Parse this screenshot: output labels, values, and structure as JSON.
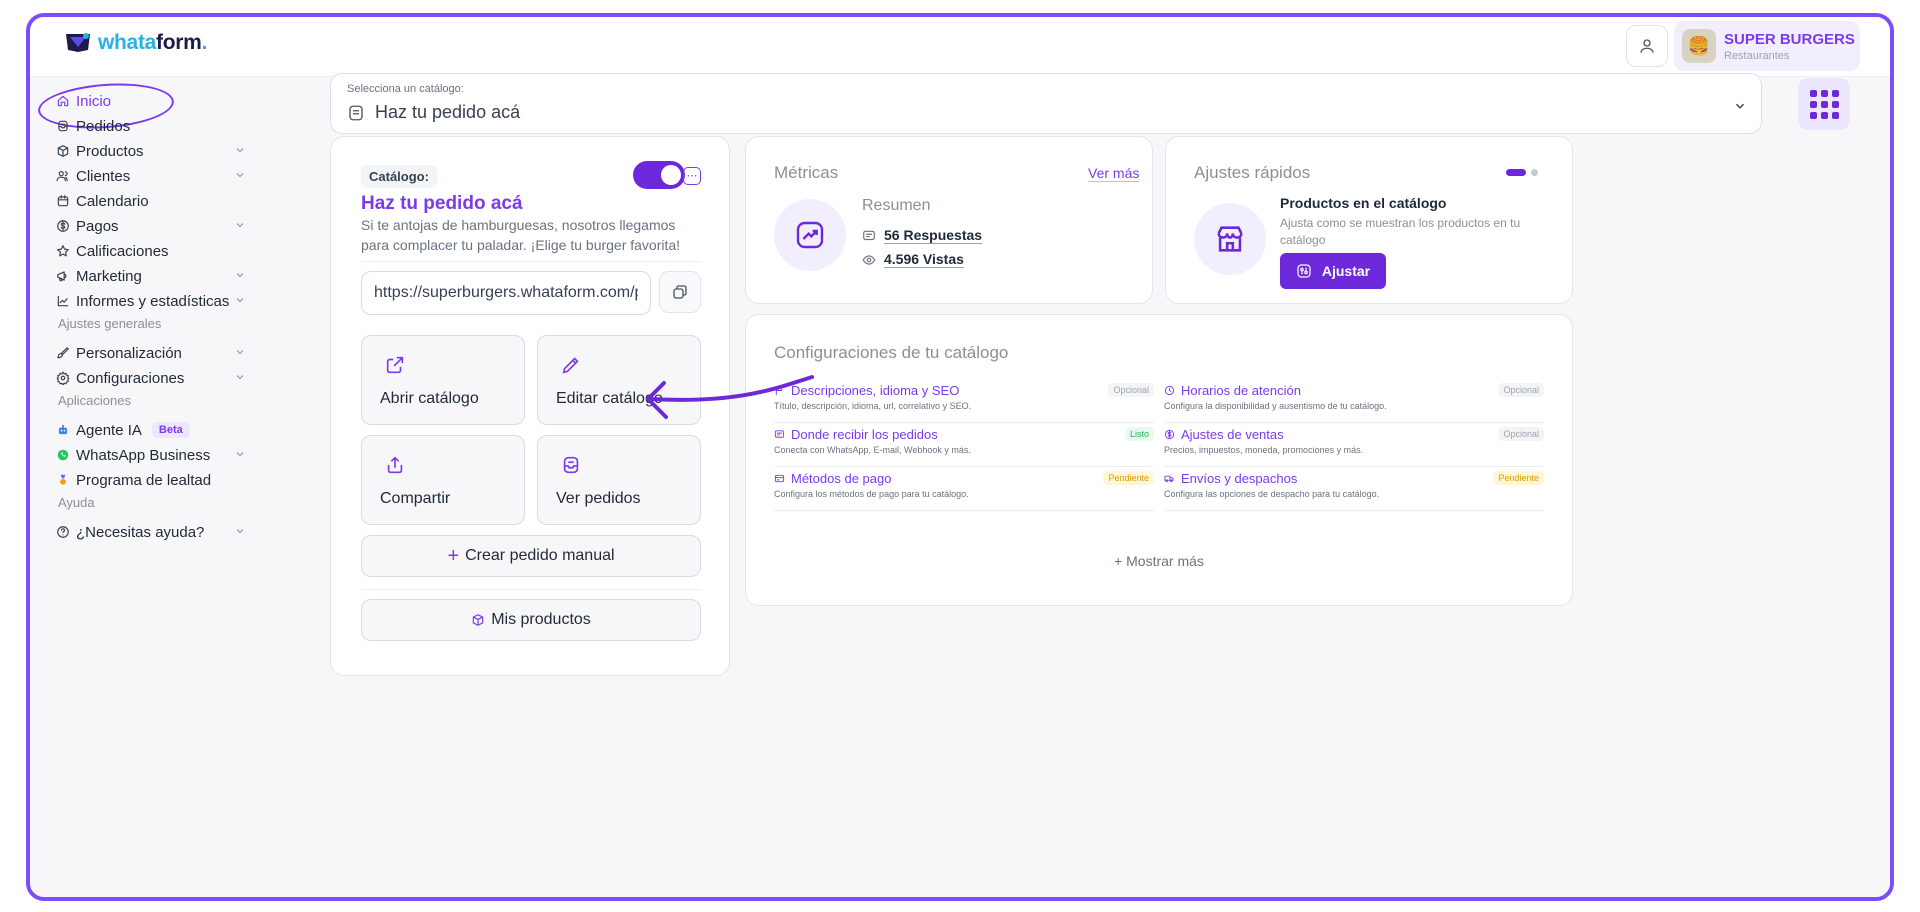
{
  "brand": {
    "name_part1": "whata",
    "name_part2": "form",
    "name_dot": "."
  },
  "account": {
    "name": "SUPER BURGERS",
    "subtitle": "Restaurantes"
  },
  "sidebar": {
    "items": [
      {
        "label": "Inicio",
        "icon": "home-icon",
        "chevron": false,
        "active": true
      },
      {
        "label": "Pedidos",
        "icon": "orders-icon",
        "chevron": false
      },
      {
        "label": "Productos",
        "icon": "box-icon",
        "chevron": true
      },
      {
        "label": "Clientes",
        "icon": "users-icon",
        "chevron": true
      },
      {
        "label": "Calendario",
        "icon": "calendar-icon",
        "chevron": false
      },
      {
        "label": "Pagos",
        "icon": "dollar-icon",
        "chevron": true
      },
      {
        "label": "Calificaciones",
        "icon": "star-icon",
        "chevron": false
      },
      {
        "label": "Marketing",
        "icon": "megaphone-icon",
        "chevron": true
      },
      {
        "label": "Informes y estadísticas",
        "icon": "chart-icon",
        "chevron": true
      }
    ],
    "heading_general": "Ajustes generales",
    "general_items": [
      {
        "label": "Personalización",
        "icon": "brush-icon",
        "chevron": true
      },
      {
        "label": "Configuraciones",
        "icon": "gear-icon",
        "chevron": true
      }
    ],
    "heading_apps": "Aplicaciones",
    "app_items": [
      {
        "label": "Agente IA",
        "icon": "robot-icon",
        "badge": "Beta",
        "chevron": false
      },
      {
        "label": "WhatsApp Business",
        "icon": "whatsapp-icon",
        "chevron": true
      },
      {
        "label": "Programa de lealtad",
        "icon": "medal-icon",
        "chevron": false
      }
    ],
    "heading_help": "Ayuda",
    "help_items": [
      {
        "label": "¿Necesitas ayuda?",
        "icon": "help-icon",
        "chevron": true
      }
    ]
  },
  "selector": {
    "label": "Selecciona un catálogo:",
    "value": "Haz tu pedido acá"
  },
  "catalog": {
    "tag": "Catálogo:",
    "enabled": true,
    "title": "Haz tu pedido acá",
    "description": "Si te antojas de hamburguesas, nosotros llegamos para complacer tu paladar. ¡Elige tu burger favorita!",
    "url": "https://superburgers.whataform.com/pedido",
    "tiles": [
      {
        "label": "Abrir catálogo",
        "icon": "external-link-icon"
      },
      {
        "label": "Editar catálogo",
        "icon": "pencil-icon"
      },
      {
        "label": "Compartir",
        "icon": "share-icon"
      },
      {
        "label": "Ver pedidos",
        "icon": "orders-box-icon"
      }
    ],
    "create_order": "Crear pedido manual",
    "my_products": "Mis productos"
  },
  "metrics": {
    "title": "Métricas",
    "more": "Ver más",
    "summary": "Resumen",
    "responses": "56 Respuestas",
    "views": "4.596 Vistas"
  },
  "quick": {
    "title": "Ajustes rápidos",
    "item_title": "Productos en el catálogo",
    "item_desc": "Ajusta como se muestran los productos en tu catálogo",
    "button": "Ajustar"
  },
  "config": {
    "title": "Configuraciones de tu catálogo",
    "items": [
      {
        "name": "Descripciones, idioma y SEO",
        "desc": "Título, descripción, idioma, url, correlativo y SEO.",
        "badge": "Opcional",
        "status": "opc",
        "icon": "flag-icon"
      },
      {
        "name": "Horarios de atención",
        "desc": "Configura la disponibilidad y ausentismo de tu catálogo.",
        "badge": "Opcional",
        "status": "opc",
        "icon": "clock-icon"
      },
      {
        "name": "Donde recibir los pedidos",
        "desc": "Conecta con WhatsApp, E-mail, Webhook y más.",
        "badge": "Listo",
        "status": "listo",
        "icon": "message-icon"
      },
      {
        "name": "Ajustes de ventas",
        "desc": "Precios, impuestos, moneda, promociones y más.",
        "badge": "Opcional",
        "status": "opc",
        "icon": "dollar-icon"
      },
      {
        "name": "Métodos de pago",
        "desc": "Configura los métodos de pago para tu catálogo.",
        "badge": "Pendiente",
        "status": "pend",
        "icon": "card-icon"
      },
      {
        "name": "Envíos y despachos",
        "desc": "Configura las opciones de despacho para tu catálogo.",
        "badge": "Pendiente",
        "status": "pend",
        "icon": "truck-icon"
      }
    ],
    "show_more": "Mostrar más"
  },
  "colors": {
    "accent": "#6d28d9",
    "accent_light": "#f3eefe",
    "frame": "#7c4dff"
  }
}
